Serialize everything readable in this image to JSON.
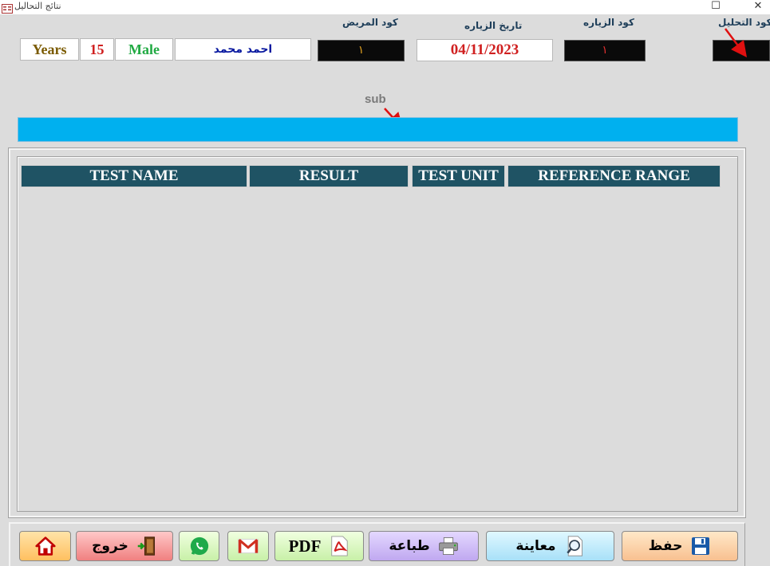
{
  "window": {
    "title": "نتائج التحاليل",
    "maximize_glyph": "☐",
    "close_glyph": "✕"
  },
  "labels": {
    "analysis_code": "كود التحليل",
    "visit_code": "كود الزياره",
    "visit_date": "تاريخ الزياره",
    "patient_code": "كود المريض"
  },
  "patient": {
    "age_unit": "Years",
    "age": "15",
    "gender": "Male",
    "name": "احمد محمد",
    "patient_code": "١",
    "visit_date": "04/11/2023",
    "visit_code": "١",
    "analysis_code": ""
  },
  "sub_label": "sub",
  "table": {
    "headers": [
      "TEST NAME",
      "RESULT",
      "TEST UNIT",
      "REFERENCE RANGE"
    ],
    "rows": []
  },
  "buttons": {
    "home": "",
    "exit": "خروج",
    "whatsapp": "",
    "gmail": "",
    "pdf": "PDF",
    "print": "طباعة",
    "preview": "معاينة",
    "save": "حفظ"
  },
  "colors": {
    "sub_bar": "#00b0ef",
    "header_bg": "#1f5364",
    "age_unit": "#7a5a00",
    "age": "#d02020",
    "gender": "#22aa44",
    "name": "#0a1aa0",
    "date": "#d02020",
    "annotation_arrow": "#e01010"
  }
}
